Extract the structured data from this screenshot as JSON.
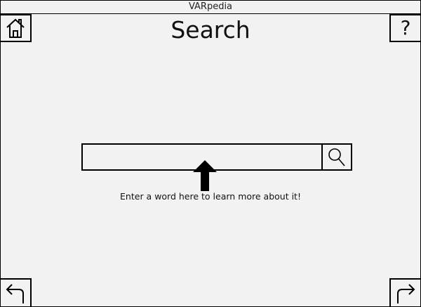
{
  "window": {
    "title": "VARpedia"
  },
  "header": {
    "page_title": "Search",
    "help_label": "?"
  },
  "search": {
    "value": "",
    "placeholder": ""
  },
  "hint": {
    "text": "Enter a word here to learn more about it!"
  },
  "icons": {
    "home": "home-icon",
    "search": "magnifier-icon",
    "back": "back-arrow-icon",
    "forward": "forward-arrow-icon",
    "hint_arrow": "up-arrow-icon"
  }
}
